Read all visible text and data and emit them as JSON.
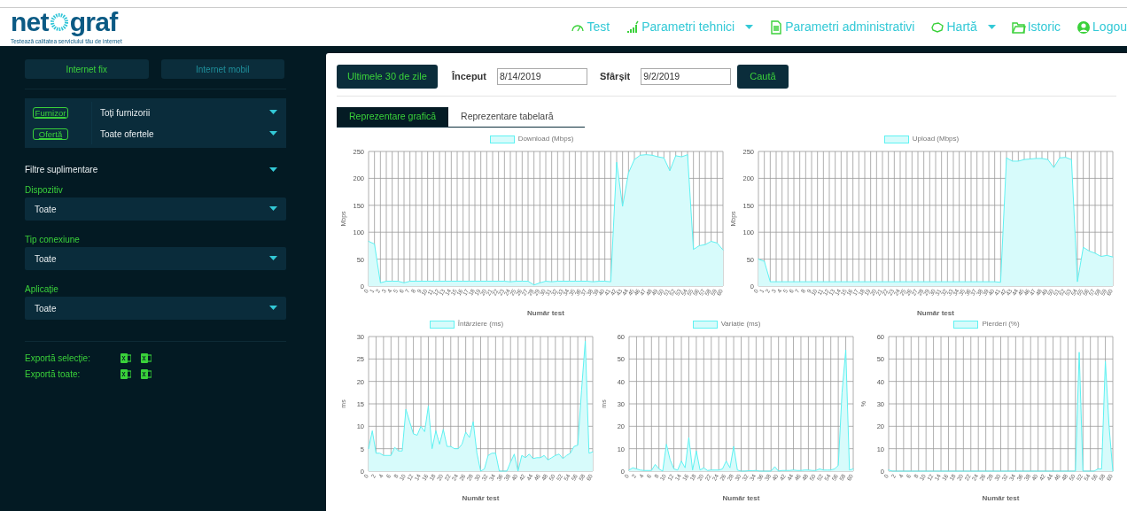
{
  "header": {
    "logo": {
      "left": "net",
      "right": "graf"
    },
    "tagline": "Testează calitatea serviciului tău de internet",
    "nav": [
      {
        "kind": "gauge",
        "label": "Test",
        "dropdown": false
      },
      {
        "kind": "bars",
        "label": "Parametri tehnici",
        "dropdown": true
      },
      {
        "kind": "document",
        "label": "Parametri administrativi",
        "dropdown": false
      },
      {
        "kind": "map",
        "label": "Hartă",
        "dropdown": true
      },
      {
        "kind": "folder",
        "label": "Istoric",
        "dropdown": false
      },
      {
        "kind": "user",
        "label": "Logou",
        "dropdown": false
      }
    ]
  },
  "sidebar": {
    "connection_tabs": [
      {
        "label": "Internet fix",
        "selected": true
      },
      {
        "label": "Internet mobil",
        "selected": false
      }
    ],
    "main_filters": [
      {
        "badge": "Furnizor",
        "value": "Toți furnizorii"
      },
      {
        "badge": "Ofertă",
        "value": "Toate ofertele"
      }
    ],
    "extra_filters": {
      "title": "Filtre suplimentare",
      "fields": [
        {
          "label": "Dispozitiv",
          "value": "Toate"
        },
        {
          "label": "Tip conexiune",
          "value": "Toate"
        },
        {
          "label": "Aplicație",
          "value": "Toate"
        }
      ]
    },
    "exports": [
      {
        "label": "Exportă selecție:"
      },
      {
        "label": "Exportă toate:"
      }
    ]
  },
  "toolbar": {
    "preset_button": "Ultimele 30 de zile",
    "start_label": "Început",
    "start_value": "8/14/2019",
    "end_label": "Sfârșit",
    "end_value": "9/2/2019",
    "search_button": "Caută"
  },
  "view_tabs": [
    {
      "label": "Reprezentare grafică",
      "selected": true
    },
    {
      "label": "Reprezentare tabelară",
      "selected": false
    }
  ],
  "charts": [
    {
      "chart_data": {
        "type": "area",
        "xlabel": "Număr test",
        "ylabel": "Mbps",
        "ylim": [
          0,
          250
        ],
        "yticks": [
          0,
          50,
          100,
          150,
          200,
          250
        ],
        "x": [
          0,
          1,
          2,
          3,
          4,
          5,
          6,
          7,
          8,
          9,
          10,
          11,
          12,
          13,
          14,
          15,
          16,
          17,
          18,
          19,
          20,
          21,
          22,
          23,
          24,
          25,
          26,
          27,
          28,
          29,
          30,
          31,
          32,
          33,
          34,
          35,
          36,
          37,
          38,
          39,
          40,
          41,
          42,
          43,
          44,
          45,
          46,
          47,
          48,
          49,
          50,
          51,
          52,
          53,
          54,
          55,
          56,
          57,
          58,
          59,
          60
        ],
        "xticks": [
          0,
          1,
          2,
          3,
          4,
          5,
          6,
          7,
          8,
          9,
          10,
          11,
          12,
          13,
          14,
          15,
          16,
          17,
          18,
          19,
          20,
          21,
          22,
          23,
          24,
          25,
          26,
          27,
          28,
          29,
          30,
          31,
          32,
          33,
          34,
          35,
          36,
          37,
          38,
          39,
          40,
          41,
          42,
          43,
          44,
          45,
          46,
          47,
          48,
          49,
          50,
          51,
          52,
          53,
          54,
          55,
          56,
          57,
          58,
          59,
          60
        ],
        "xlim": [
          0,
          60
        ],
        "grid": true,
        "series": [
          {
            "name": "Download (Mbps)",
            "color": "#5ef2f2",
            "values": [
              83,
              78,
              6,
              9,
              9,
              9,
              6,
              9,
              9,
              9,
              9,
              9,
              9,
              9,
              9,
              9,
              9,
              9,
              9,
              9,
              9,
              9,
              9,
              9,
              8,
              9,
              9,
              9,
              2,
              6,
              9,
              8,
              9,
              9,
              9,
              9,
              9,
              9,
              8,
              9,
              9,
              8,
              230,
              148,
              210,
              235,
              243,
              244,
              243,
              240,
              238,
              214,
              242,
              240,
              244,
              68,
              75,
              77,
              83,
              80,
              67
            ]
          }
        ]
      }
    },
    {
      "chart_data": {
        "type": "area",
        "xlabel": "Număr test",
        "ylabel": "Mbps",
        "ylim": [
          0,
          250
        ],
        "yticks": [
          0,
          50,
          100,
          150,
          200,
          250
        ],
        "x": [
          0,
          1,
          2,
          3,
          4,
          5,
          6,
          7,
          8,
          9,
          10,
          11,
          12,
          13,
          14,
          15,
          16,
          17,
          18,
          19,
          20,
          21,
          22,
          23,
          24,
          25,
          26,
          27,
          28,
          29,
          30,
          31,
          32,
          33,
          34,
          35,
          36,
          37,
          38,
          39,
          40,
          41,
          42,
          43,
          44,
          45,
          46,
          47,
          48,
          49,
          50,
          51,
          52,
          53,
          54,
          55,
          56,
          57,
          58,
          59,
          60
        ],
        "xticks": [
          0,
          1,
          2,
          3,
          4,
          5,
          6,
          7,
          8,
          9,
          10,
          11,
          12,
          13,
          14,
          15,
          16,
          17,
          18,
          19,
          20,
          21,
          22,
          23,
          24,
          25,
          26,
          27,
          28,
          29,
          30,
          31,
          32,
          33,
          34,
          35,
          36,
          37,
          38,
          39,
          40,
          41,
          42,
          43,
          44,
          45,
          46,
          47,
          48,
          49,
          50,
          51,
          52,
          53,
          54,
          55,
          56,
          57,
          58,
          59,
          60
        ],
        "xlim": [
          0,
          60
        ],
        "grid": true,
        "series": [
          {
            "name": "Upload (Mbps)",
            "color": "#5ef2f2",
            "values": [
              50,
              46,
              8,
              8,
              8,
              8,
              8,
              8,
              8,
              8,
              8,
              8,
              8,
              8,
              8,
              8,
              8,
              8,
              8,
              8,
              8,
              8,
              8,
              8,
              8,
              8,
              8,
              8,
              8,
              8,
              8,
              8,
              8,
              8,
              8,
              8,
              8,
              8,
              8,
              8,
              8,
              7,
              238,
              232,
              232,
              235,
              236,
              237,
              237,
              235,
              220,
              238,
              239,
              235,
              8,
              72,
              65,
              61,
              55,
              57,
              54
            ]
          }
        ]
      }
    },
    {
      "chart_data": {
        "type": "area",
        "xlabel": "Număr test",
        "ylabel": "ms",
        "ylim": [
          0,
          30
        ],
        "yticks": [
          0,
          5,
          10,
          15,
          20,
          25,
          30
        ],
        "x": [
          0,
          1,
          2,
          3,
          4,
          5,
          6,
          7,
          8,
          9,
          10,
          11,
          12,
          13,
          14,
          15,
          16,
          17,
          18,
          19,
          20,
          21,
          22,
          23,
          24,
          25,
          26,
          27,
          28,
          29,
          30,
          31,
          32,
          33,
          34,
          35,
          36,
          37,
          38,
          39,
          40,
          41,
          42,
          43,
          44,
          45,
          46,
          47,
          48,
          49,
          50,
          51,
          52,
          53,
          54,
          55,
          56,
          57,
          58,
          59,
          60
        ],
        "xticks": [
          0,
          2,
          4,
          6,
          8,
          10,
          12,
          14,
          16,
          18,
          20,
          22,
          24,
          26,
          28,
          30,
          32,
          34,
          36,
          38,
          40,
          42,
          44,
          46,
          48,
          50,
          52,
          54,
          56,
          58,
          60
        ],
        "xlim": [
          0,
          60
        ],
        "grid": true,
        "series": [
          {
            "name": "Întârziere (ms)",
            "color": "#5ef2f2",
            "values": [
              5,
              9,
              4,
              4,
              3.5,
              3.5,
              3.5,
              5.3,
              4.5,
              4.5,
              13.8,
              11,
              8.3,
              8,
              10,
              8.8,
              14.5,
              5,
              9,
              6,
              9.3,
              5.5,
              5.5,
              5,
              5,
              6,
              8.7,
              7.5,
              11,
              4,
              0,
              0.5,
              3.5,
              4,
              4,
              0,
              0,
              0,
              2,
              3.8,
              0,
              3.5,
              3,
              3.8,
              2.8,
              3,
              3,
              3.5,
              2.5,
              3,
              3.5,
              3.8,
              2.8,
              3.5,
              4,
              5.5,
              5.8,
              18,
              29,
              4,
              4.3
            ]
          }
        ]
      }
    },
    {
      "chart_data": {
        "type": "area",
        "xlabel": "Număr test",
        "ylabel": "ms",
        "ylim": [
          0,
          60
        ],
        "yticks": [
          0,
          10,
          20,
          30,
          40,
          50,
          60
        ],
        "x": [
          0,
          1,
          2,
          3,
          4,
          5,
          6,
          7,
          8,
          9,
          10,
          11,
          12,
          13,
          14,
          15,
          16,
          17,
          18,
          19,
          20,
          21,
          22,
          23,
          24,
          25,
          26,
          27,
          28,
          29,
          30,
          31,
          32,
          33,
          34,
          35,
          36,
          37,
          38,
          39,
          40,
          41,
          42,
          43,
          44,
          45,
          46,
          47,
          48,
          49,
          50,
          51,
          52,
          53,
          54,
          55,
          56,
          57,
          58,
          59,
          60
        ],
        "xticks": [
          0,
          2,
          4,
          6,
          8,
          10,
          12,
          14,
          16,
          18,
          20,
          22,
          24,
          26,
          28,
          30,
          32,
          34,
          36,
          38,
          40,
          42,
          44,
          46,
          48,
          50,
          52,
          54,
          56,
          58,
          60
        ],
        "xlim": [
          0,
          60
        ],
        "grid": true,
        "series": [
          {
            "name": "Variație (ms)",
            "color": "#5ef2f2",
            "values": [
              0.5,
              1.5,
              1,
              0.5,
              0.3,
              0.3,
              0.3,
              3,
              1,
              0,
              12,
              5,
              1,
              0.5,
              4.5,
              1.5,
              15,
              0.5,
              9,
              0.5,
              1.5,
              0.3,
              0.5,
              0.5,
              0.5,
              1,
              4.5,
              1.5,
              11,
              0.5,
              0,
              0,
              0.2,
              0.2,
              0.3,
              0,
              0,
              0,
              0,
              2,
              0,
              0.3,
              0.3,
              0.3,
              0.5,
              0.3,
              0.3,
              0.5,
              0.5,
              0.3,
              0.3,
              1,
              0.5,
              0.5,
              0.5,
              1,
              2.5,
              35,
              54,
              0.5,
              1
            ]
          }
        ]
      }
    },
    {
      "chart_data": {
        "type": "area",
        "xlabel": "Număr test",
        "ylabel": "%",
        "ylim": [
          0,
          60
        ],
        "yticks": [
          0,
          10,
          20,
          30,
          40,
          50,
          60
        ],
        "x": [
          0,
          1,
          2,
          3,
          4,
          5,
          6,
          7,
          8,
          9,
          10,
          11,
          12,
          13,
          14,
          15,
          16,
          17,
          18,
          19,
          20,
          21,
          22,
          23,
          24,
          25,
          26,
          27,
          28,
          29,
          30,
          31,
          32,
          33,
          34,
          35,
          36,
          37,
          38,
          39,
          40,
          41,
          42,
          43,
          44,
          45,
          46,
          47,
          48,
          49,
          50,
          51,
          52,
          53,
          54,
          55,
          56,
          57,
          58,
          59,
          60
        ],
        "xticks": [
          0,
          2,
          4,
          6,
          8,
          10,
          12,
          14,
          16,
          18,
          20,
          22,
          24,
          26,
          28,
          30,
          32,
          34,
          36,
          38,
          40,
          42,
          44,
          46,
          48,
          50,
          52,
          54,
          56,
          58,
          60
        ],
        "xlim": [
          0,
          60
        ],
        "grid": true,
        "series": [
          {
            "name": "Pierderi (%)",
            "color": "#5ef2f2",
            "values": [
              0.5,
              0,
              0,
              0,
              0,
              0,
              0,
              0,
              0,
              0,
              0,
              0,
              0,
              0,
              0,
              0,
              0,
              0,
              0,
              0,
              0,
              0,
              0,
              0,
              0,
              0,
              0,
              0,
              0,
              0,
              0,
              0,
              0,
              0,
              0,
              0,
              0,
              0,
              0,
              0,
              0,
              0,
              0,
              0,
              0,
              0,
              0,
              0,
              0,
              0,
              0,
              53,
              0,
              0,
              0,
              0,
              1,
              1,
              49,
              20,
              0
            ]
          }
        ]
      }
    }
  ]
}
